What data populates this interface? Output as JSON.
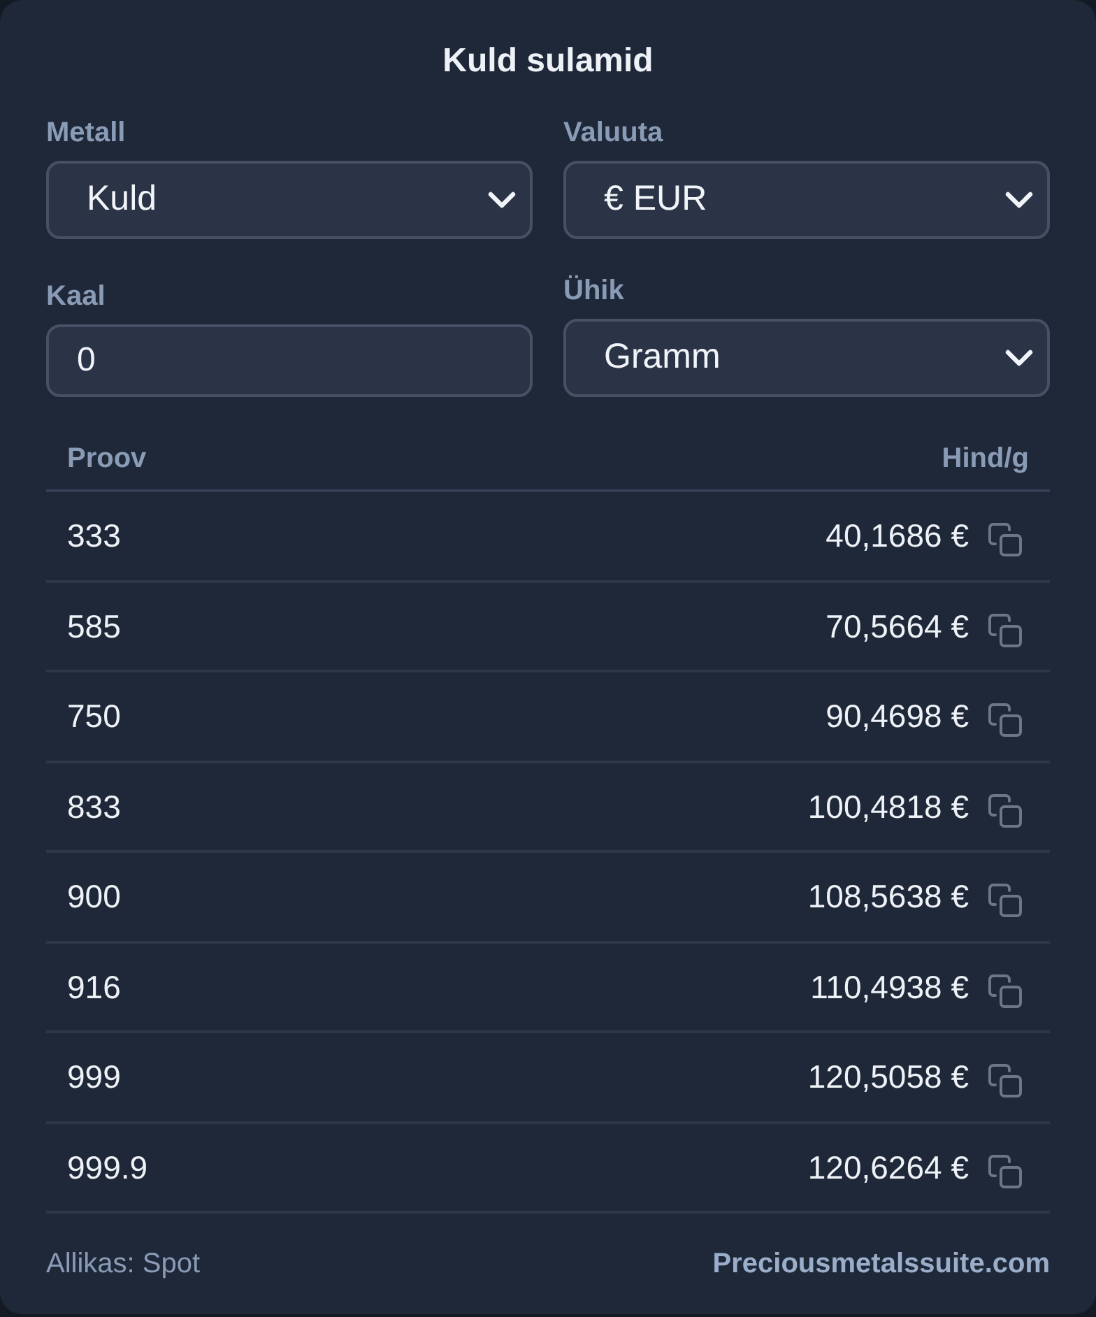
{
  "title": "Kuld sulamid",
  "fields": [
    {
      "kind": "select",
      "label": "Metall",
      "value": "Kuld"
    },
    {
      "kind": "select",
      "label": "Valuuta",
      "value": "€ EUR"
    },
    {
      "kind": "input",
      "label": "Kaal",
      "value": "0"
    },
    {
      "kind": "select",
      "label": "Ühik",
      "value": "Gramm"
    }
  ],
  "table": {
    "columns": [
      "Proov",
      "Hind/g"
    ],
    "rows": [
      {
        "purity": "333",
        "price": "40,1686 €"
      },
      {
        "purity": "585",
        "price": "70,5664 €"
      },
      {
        "purity": "750",
        "price": "90,4698 €"
      },
      {
        "purity": "833",
        "price": "100,4818 €"
      },
      {
        "purity": "900",
        "price": "108,5638 €"
      },
      {
        "purity": "916",
        "price": "110,4938 €"
      },
      {
        "purity": "999",
        "price": "120,5058 €"
      },
      {
        "purity": "999.9",
        "price": "120,6264 €"
      }
    ]
  },
  "footer": {
    "source": "Allikas: Spot",
    "link": "Preciousmetalssuite.com"
  }
}
